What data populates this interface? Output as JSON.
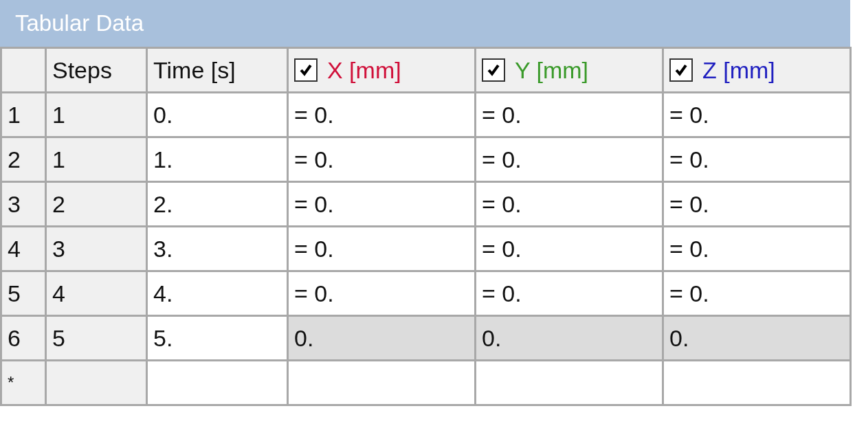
{
  "window": {
    "title": "Tabular Data"
  },
  "table": {
    "columns": [
      {
        "label": "Steps",
        "kind": "plain"
      },
      {
        "label": "Time [s]",
        "kind": "plain"
      },
      {
        "label": "X [mm]",
        "kind": "check",
        "checked": true,
        "color": "#d0103a"
      },
      {
        "label": "Y [mm]",
        "kind": "check",
        "checked": true,
        "color": "#3a9a2a"
      },
      {
        "label": "Z [mm]",
        "kind": "check",
        "checked": true,
        "color": "#2020c0"
      }
    ],
    "rows": [
      {
        "kind": "data",
        "number": "1",
        "cells": [
          "1",
          "0.",
          "= 0.",
          "= 0.",
          "= 0."
        ],
        "shaded": false
      },
      {
        "kind": "data",
        "number": "2",
        "cells": [
          "1",
          "1.",
          "= 0.",
          "= 0.",
          "= 0."
        ],
        "shaded": false
      },
      {
        "kind": "data",
        "number": "3",
        "cells": [
          "2",
          "2.",
          "= 0.",
          "= 0.",
          "= 0."
        ],
        "shaded": false
      },
      {
        "kind": "data",
        "number": "4",
        "cells": [
          "3",
          "3.",
          "= 0.",
          "= 0.",
          "= 0."
        ],
        "shaded": false
      },
      {
        "kind": "data",
        "number": "5",
        "cells": [
          "4",
          "4.",
          "= 0.",
          "= 0.",
          "= 0."
        ],
        "shaded": false
      },
      {
        "kind": "data",
        "number": "6",
        "cells": [
          "5",
          "5.",
          "0.",
          "0.",
          "0."
        ],
        "shaded": true
      },
      {
        "kind": "new",
        "number": "*"
      }
    ]
  }
}
